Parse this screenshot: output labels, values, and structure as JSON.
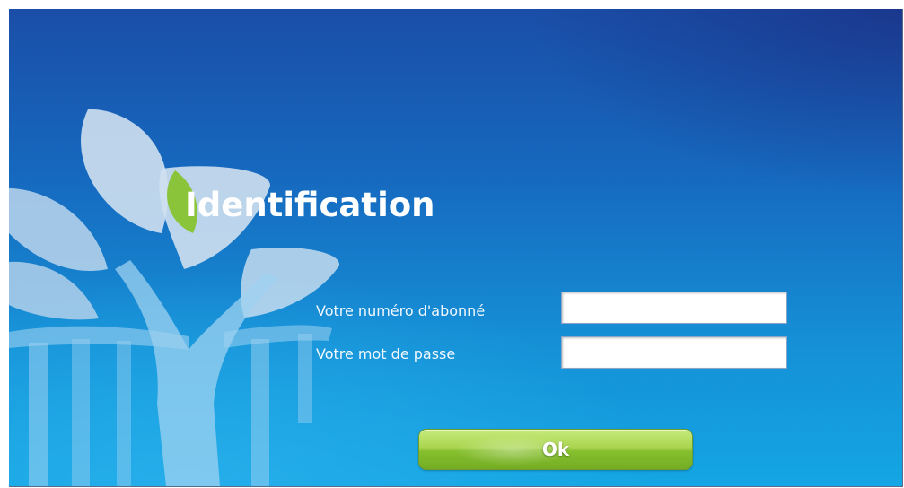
{
  "login": {
    "title": "Identification",
    "subscriber_label": "Votre numéro d'abonné",
    "subscriber_value": "",
    "password_label": "Votre mot de passe",
    "password_value": "",
    "ok_label": "Ok"
  },
  "colors": {
    "background_top": "#1a4ea8",
    "background_bottom": "#14a6e4",
    "button_green": "#86bf2e",
    "leaf_accent": "#8ac43a"
  },
  "icons": [
    "tree-logo-icon"
  ]
}
